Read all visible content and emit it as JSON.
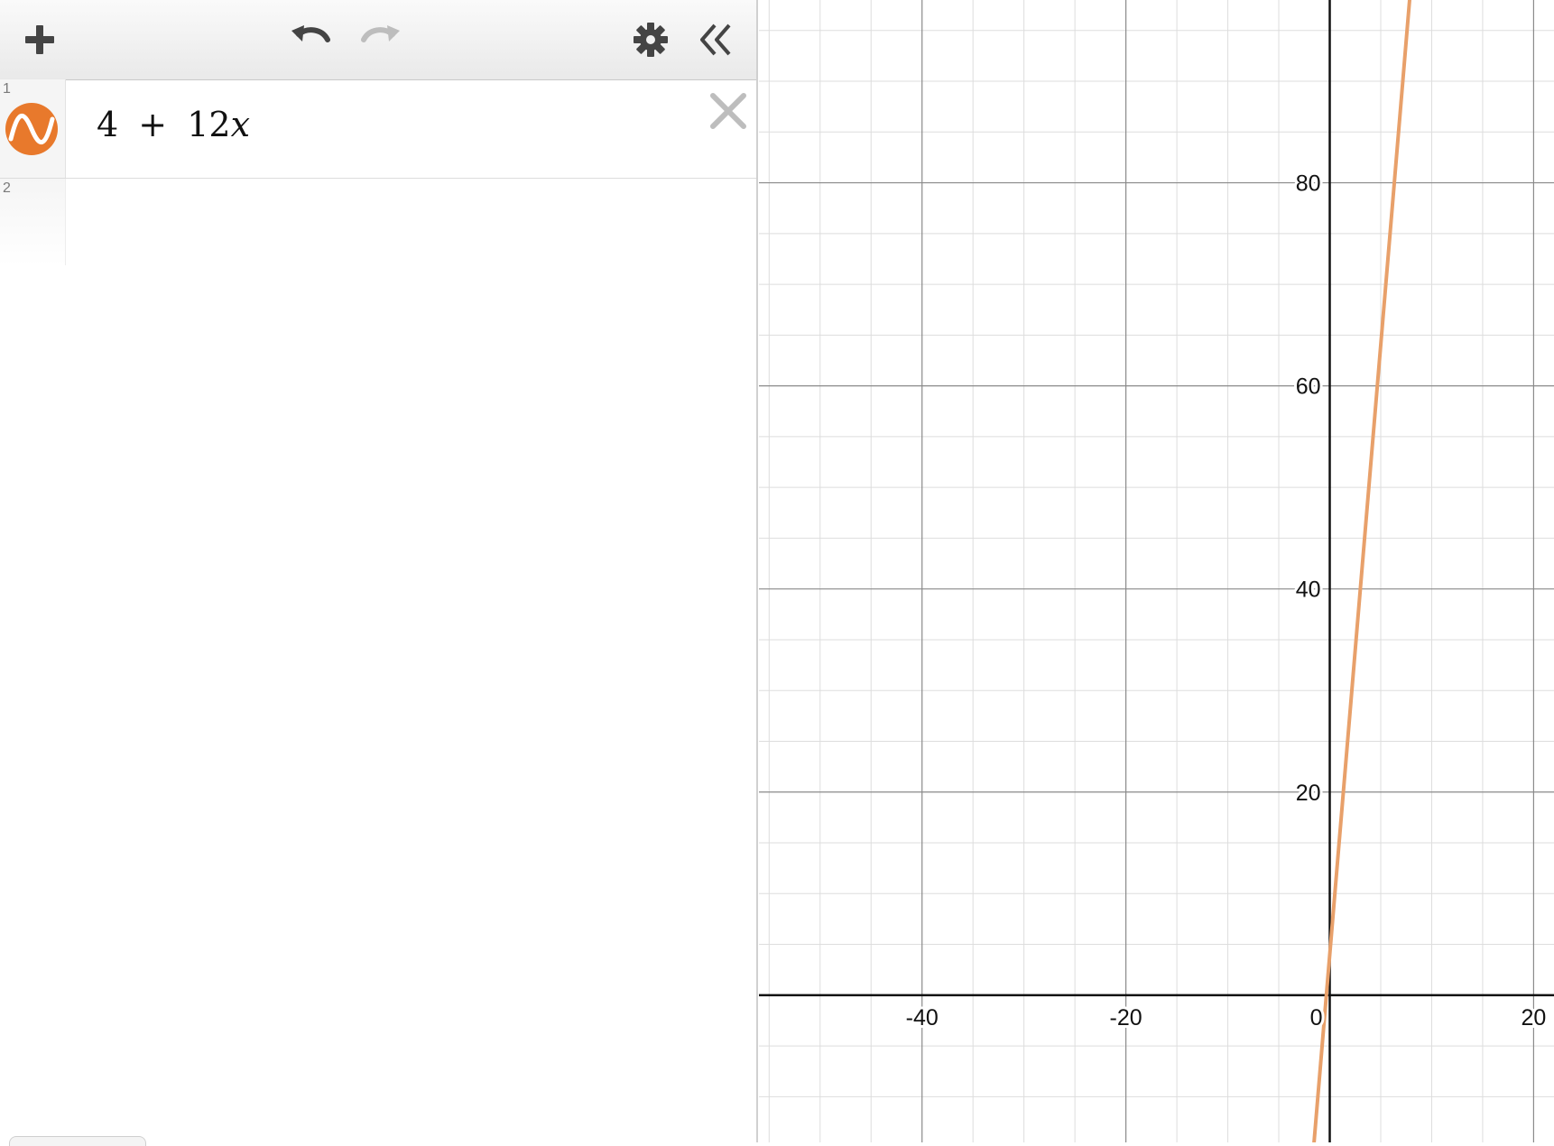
{
  "toolbar": {
    "add_icon": "plus-icon",
    "undo_icon": "undo-icon",
    "redo_icon": "redo-icon",
    "settings_icon": "gear-icon",
    "collapse_icon": "double-chevron-left-icon"
  },
  "expressions": [
    {
      "number": "1",
      "parts": {
        "constant": "4",
        "plus": "+",
        "coefficient": "12",
        "variable": "x"
      },
      "color": "#e8792c",
      "icon": "function-wave-icon"
    },
    {
      "number": "2"
    }
  ],
  "chart_data": {
    "type": "line",
    "grid": true,
    "xlim": [
      -56,
      22
    ],
    "ylim": [
      -14.5,
      98
    ],
    "x_ticks": [
      "-40",
      "-20",
      "0",
      "20"
    ],
    "y_ticks": [
      "20",
      "40",
      "60",
      "80"
    ],
    "series": [
      {
        "expression": "4 + 12x",
        "slope": 12,
        "intercept": 4,
        "color": "#e8a06a"
      }
    ]
  }
}
